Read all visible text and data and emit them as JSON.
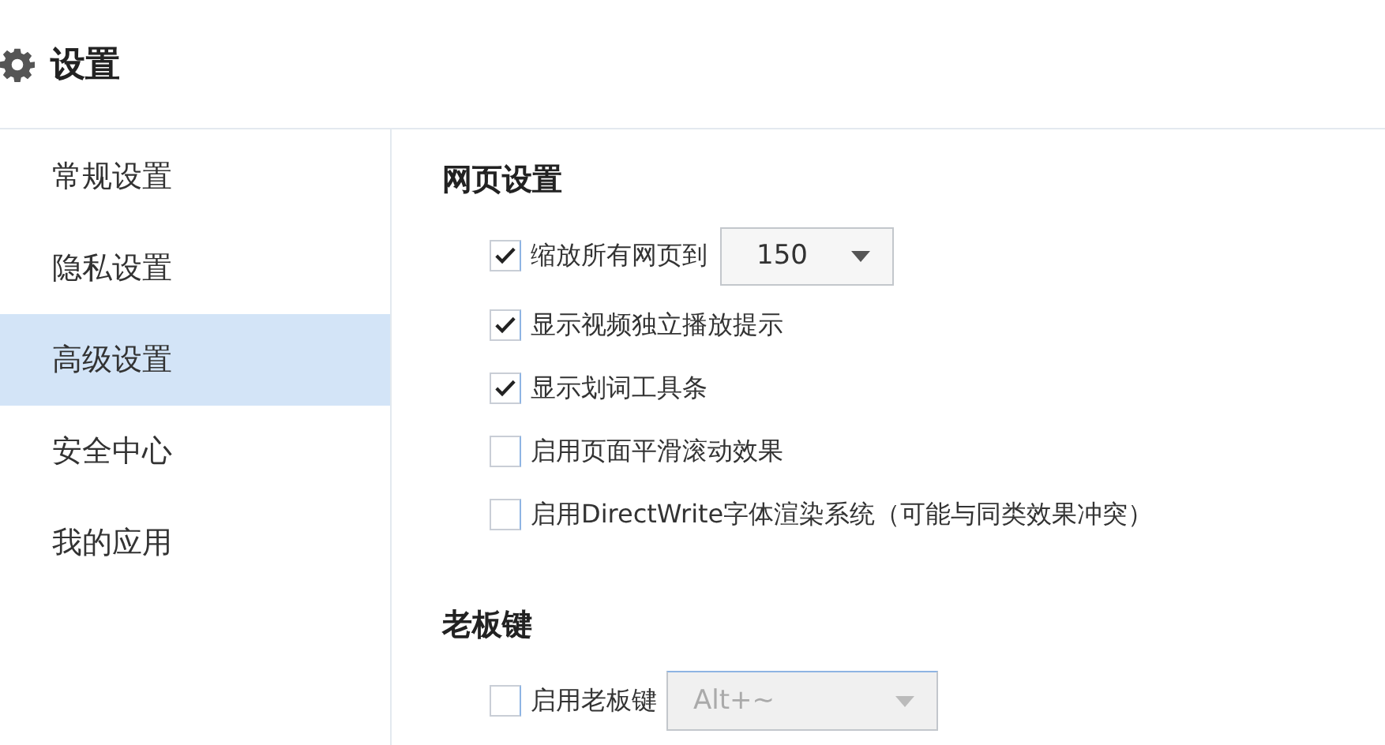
{
  "window": {
    "title": "设置"
  },
  "sidebar": {
    "items": [
      {
        "label": "常规设置",
        "selected": false
      },
      {
        "label": "隐私设置",
        "selected": false
      },
      {
        "label": "高级设置",
        "selected": true
      },
      {
        "label": "安全中心",
        "selected": false
      },
      {
        "label": "我的应用",
        "selected": false
      }
    ]
  },
  "sections": [
    {
      "title": "网页设置",
      "rows": [
        {
          "label": "缩放所有网页到",
          "checked": true,
          "dropdown": {
            "value": "150",
            "disabled": false
          }
        },
        {
          "label": "显示视频独立播放提示",
          "checked": true
        },
        {
          "label": "显示划词工具条",
          "checked": true
        },
        {
          "label": "启用页面平滑滚动效果",
          "checked": false
        },
        {
          "label": "启用DirectWrite字体渲染系统（可能与同类效果冲突）",
          "checked": false
        }
      ]
    },
    {
      "title": "老板键",
      "rows": [
        {
          "label": "启用老板键",
          "checked": false,
          "dropdown": {
            "value": "Alt+~",
            "disabled": true
          }
        }
      ]
    }
  ]
}
